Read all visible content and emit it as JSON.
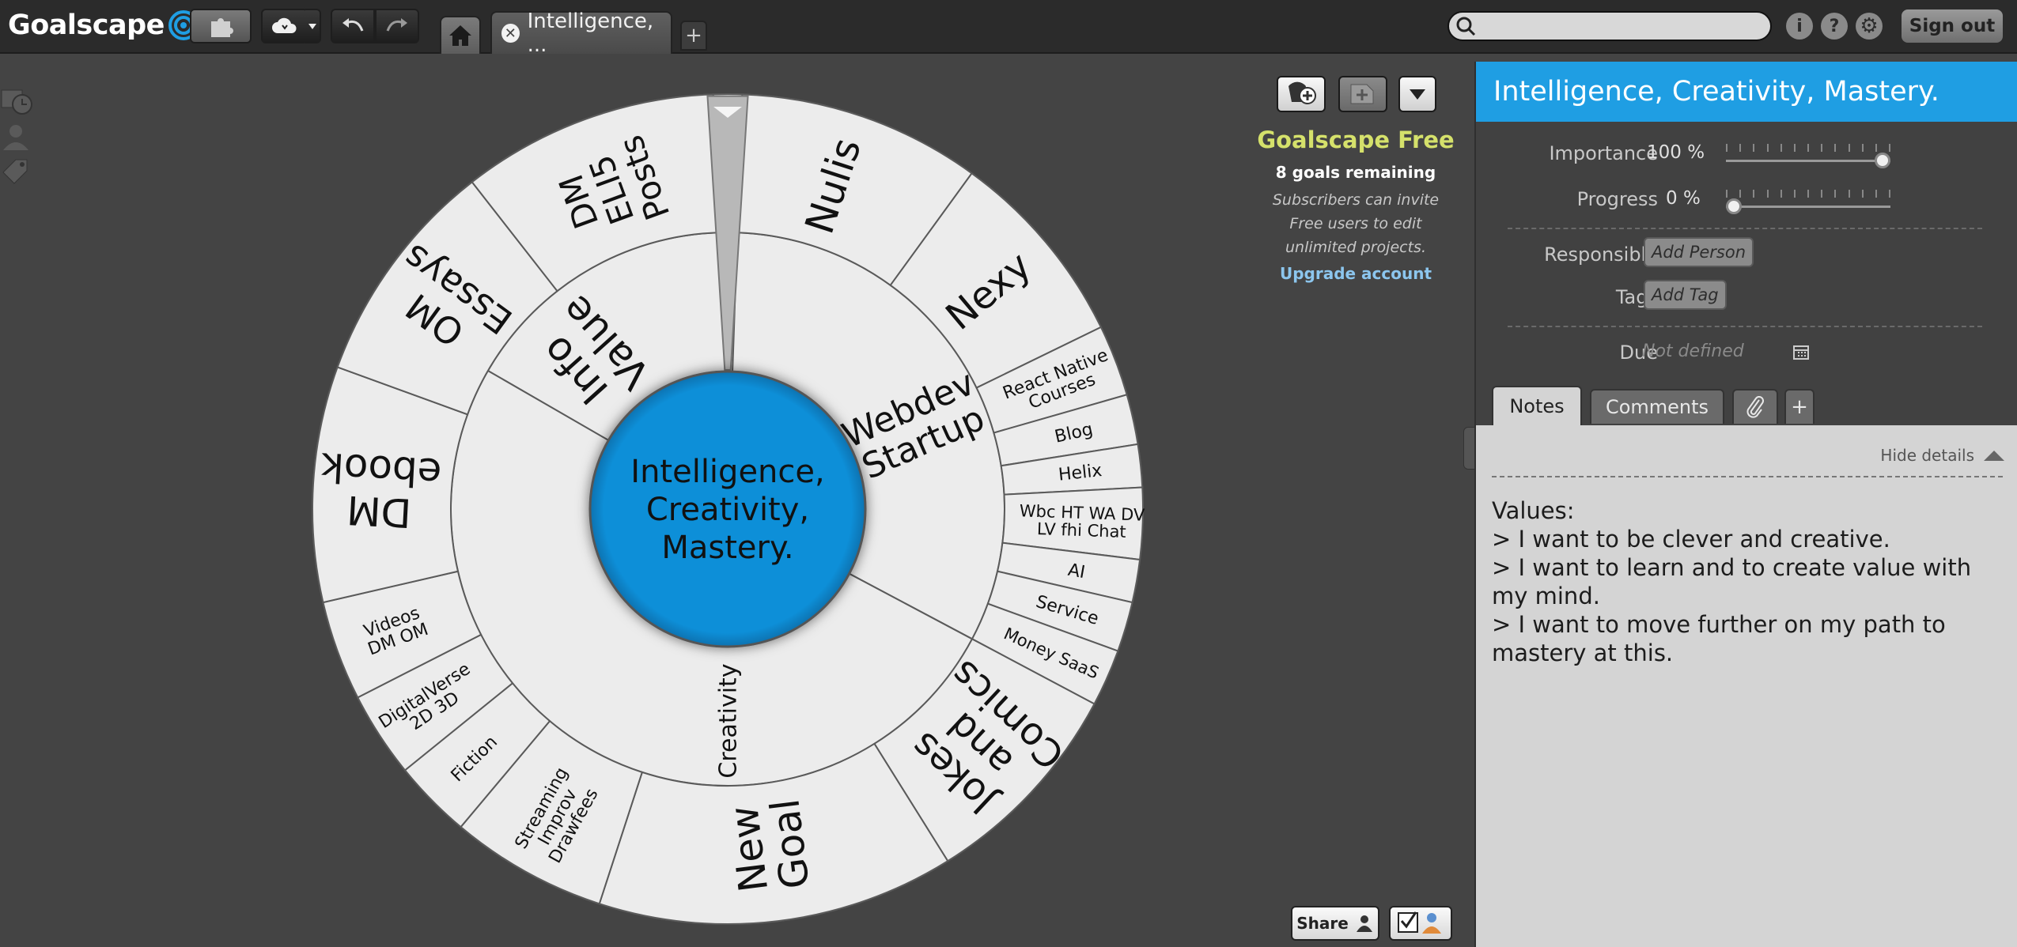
{
  "app": {
    "brand": "Goalscape",
    "accent": "#1f9ee3",
    "tabs": [
      {
        "label": "Intelligence, ..."
      }
    ],
    "search": {
      "placeholder": "",
      "value": ""
    },
    "signout_label": "Sign out"
  },
  "wheel": {
    "center": "Intelligence,\nCreativity,\nMastery.",
    "center_color": "#0e8fd8",
    "segment_color": "#ececec",
    "inner": [
      {
        "label": "Info\nValue"
      },
      {
        "label": "Webdev\nStartup"
      },
      {
        "label": "Creativity"
      }
    ],
    "outer": [
      {
        "label": "Nulis"
      },
      {
        "label": "Nexy"
      },
      {
        "label": "React Native\nCourses"
      },
      {
        "label": "Blog"
      },
      {
        "label": "Helix"
      },
      {
        "label": "Wbc HT WA DV\nLV fhi Chat"
      },
      {
        "label": "AI"
      },
      {
        "label": "Service"
      },
      {
        "label": "Money SaaS"
      },
      {
        "label": "Jokes\nand\nComics"
      },
      {
        "label": "New\nGoal"
      },
      {
        "label": "Streaming\nImprov\nDrawfees"
      },
      {
        "label": "Fiction"
      },
      {
        "label": "DigitalVerse\n2D 3D"
      },
      {
        "label": "Videos\nDM OM"
      },
      {
        "label": "DM\nebook"
      },
      {
        "label": "OM\nEssays"
      },
      {
        "label": "DM\nELI5\nPosts"
      }
    ]
  },
  "plan": {
    "name": "Goalscape Free",
    "goals_remaining": "8 goals remaining",
    "subscriber_note": "Subscribers can invite Free users to edit unlimited projects.",
    "upgrade_label": "Upgrade account",
    "share_label": "Share"
  },
  "details": {
    "title": "Intelligence, Creativity, Mastery.",
    "importance_label": "Importance",
    "importance_value": "100 %",
    "importance_fraction": 1.0,
    "progress_label": "Progress",
    "progress_value": "0 %",
    "progress_fraction": 0.0,
    "responsible_label": "Responsible",
    "add_person": "Add Person",
    "tags_label": "Tags",
    "add_tag": "Add Tag",
    "due_label": "Due",
    "due_value": "Not defined",
    "tabs": [
      {
        "label": "Notes"
      },
      {
        "label": "Comments"
      }
    ],
    "hide_details": "Hide details",
    "notes": [
      "Values:",
      "> I want to be clever and creative.",
      "> I want to learn and to create value with my mind.",
      "> I want to move further on my path to mastery at this."
    ]
  }
}
